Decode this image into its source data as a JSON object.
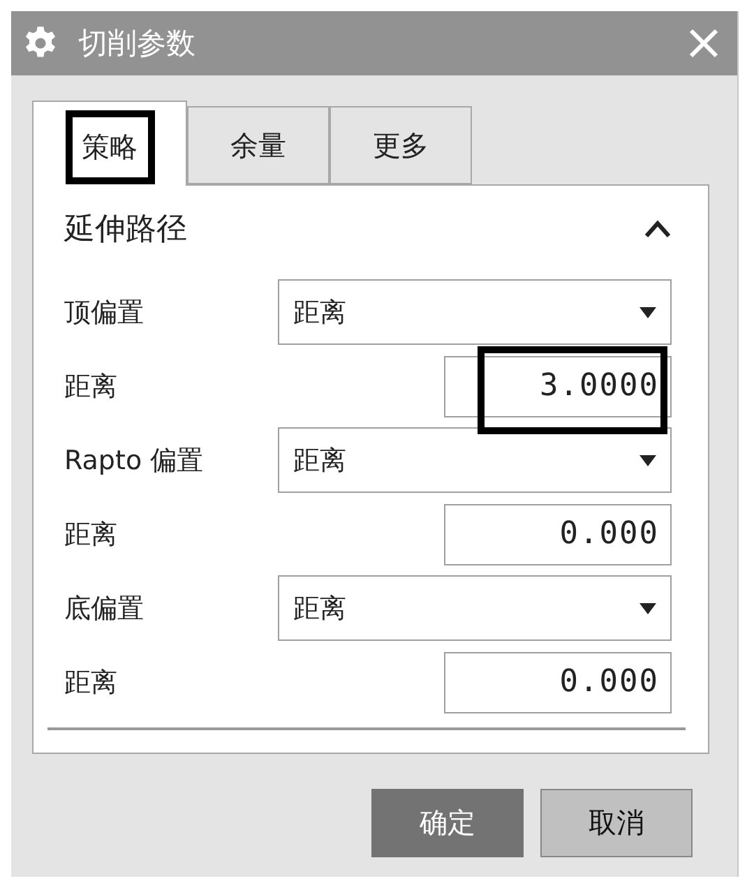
{
  "window": {
    "title": "切削参数"
  },
  "tabs": [
    {
      "label": "策略",
      "selected": true,
      "highlighted": true
    },
    {
      "label": "余量",
      "selected": false,
      "highlighted": false
    },
    {
      "label": "更多",
      "selected": false,
      "highlighted": false
    }
  ],
  "section": {
    "title": "延伸路径",
    "expanded": true
  },
  "rows": [
    {
      "kind": "dropdown",
      "label": "顶偏置",
      "value": "距离"
    },
    {
      "kind": "number",
      "label": "距离",
      "value": "3.0000",
      "highlighted": true
    },
    {
      "kind": "dropdown",
      "label": "Rapto 偏置",
      "value": "距离"
    },
    {
      "kind": "number",
      "label": "距离",
      "value": "0.000",
      "highlighted": false
    },
    {
      "kind": "dropdown",
      "label": "底偏置",
      "value": "距离"
    },
    {
      "kind": "number",
      "label": "距离",
      "value": "0.000",
      "highlighted": false
    }
  ],
  "buttons": [
    {
      "label": "确定",
      "kind": "primary"
    },
    {
      "label": "取消",
      "kind": "secondary"
    }
  ]
}
